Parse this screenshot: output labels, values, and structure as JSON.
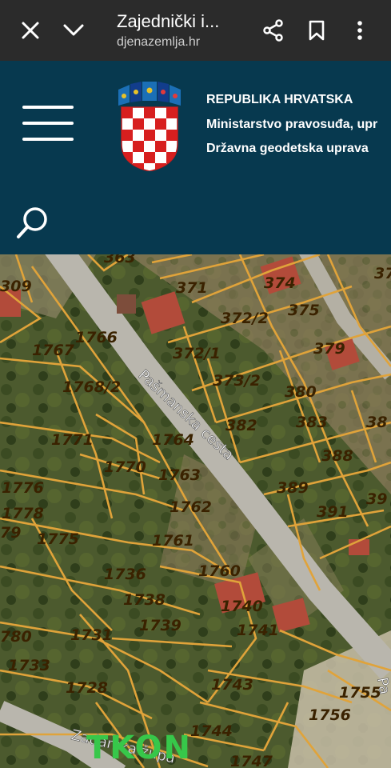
{
  "browser": {
    "title": "Zajednički i...",
    "url": "djenazemlja.hr",
    "icons": [
      "close-icon",
      "chevron-down-icon",
      "share-icon",
      "bookmark-icon",
      "more-vert-icon"
    ]
  },
  "header": {
    "line1": "REPUBLIKA HRVATSKA",
    "line2": "Ministarstvo pravosuđa, upr",
    "line3": "Državna geodetska uprava",
    "colors": {
      "background": "#07394f",
      "parcel_outline": "#e0a33a"
    }
  },
  "map": {
    "roads": [
      "Pašmanska cesta",
      "Zadarska župa",
      "Pa"
    ],
    "place_label": "TKON",
    "parcels": [
      "363",
      "309",
      "371",
      "374",
      "37",
      "372/2",
      "375",
      "379",
      "1766",
      "372/1",
      "1767",
      "373/2",
      "380",
      "1768/2",
      "382",
      "383",
      "38",
      "1771",
      "1764",
      "388",
      "1770",
      "1763",
      "1776",
      "389",
      "39",
      "1762",
      "1778",
      "391",
      "79",
      "1775",
      "1761",
      "1760",
      "1736",
      "1738",
      "1740",
      "1739",
      "1741",
      "780",
      "1731",
      "1733",
      "1728",
      "1743",
      "1755",
      "1756",
      "1744",
      "1747"
    ]
  }
}
